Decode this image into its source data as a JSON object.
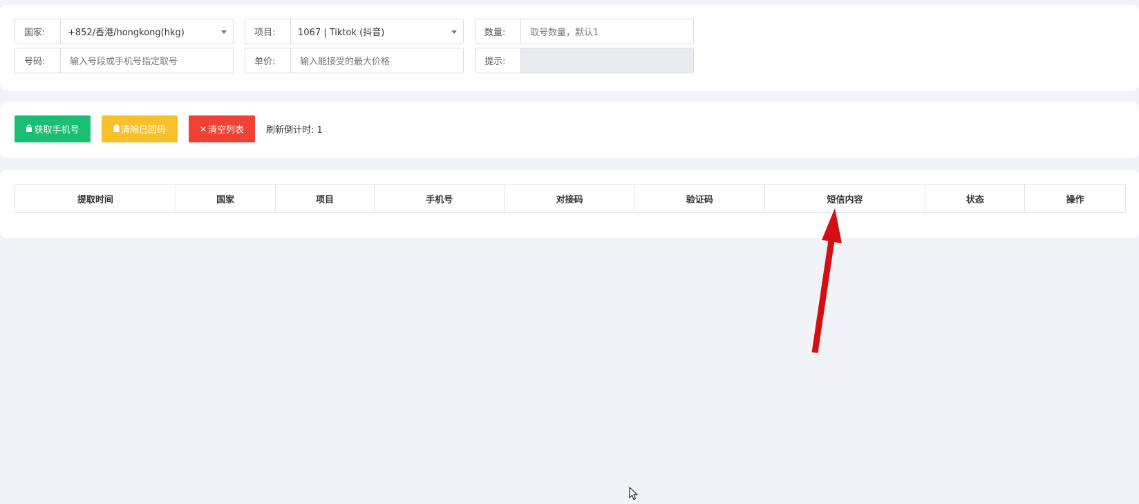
{
  "form": {
    "country": {
      "label": "国家:",
      "value": "+852/香港/hongkong(hkg)"
    },
    "project": {
      "label": "项目:",
      "value": "1067 | Tiktok (抖音)"
    },
    "quantity": {
      "label": "数量:",
      "placeholder": "取号数量，默认1"
    },
    "number": {
      "label": "号码:",
      "placeholder": "输入号段或手机号指定取号"
    },
    "price": {
      "label": "单价:",
      "placeholder": "输入能接受的最大价格"
    },
    "hint": {
      "label": "提示:",
      "value": ""
    }
  },
  "actions": {
    "get_phone_label": "获取手机号",
    "clear_received_label": "清除已回码",
    "clear_list_label": "清空列表",
    "countdown_label": "刷新倒计时: 1"
  },
  "table": {
    "columns": [
      "提取时间",
      "国家",
      "项目",
      "手机号",
      "对接码",
      "验证码",
      "短信内容",
      "状态",
      "操作"
    ]
  },
  "colors": {
    "background": "#f2f3f8",
    "green": "#1bbf74",
    "yellow": "#f8c12a",
    "red": "#f04135",
    "arrow": "#d40f14"
  },
  "icons": {
    "get_phone": "lock-icon",
    "clear_received": "clipboard-icon",
    "clear_list": "close-icon",
    "select_caret": "caret-down-icon",
    "annotation": "red-arrow-icon",
    "cursor": "mouse-pointer-icon"
  }
}
